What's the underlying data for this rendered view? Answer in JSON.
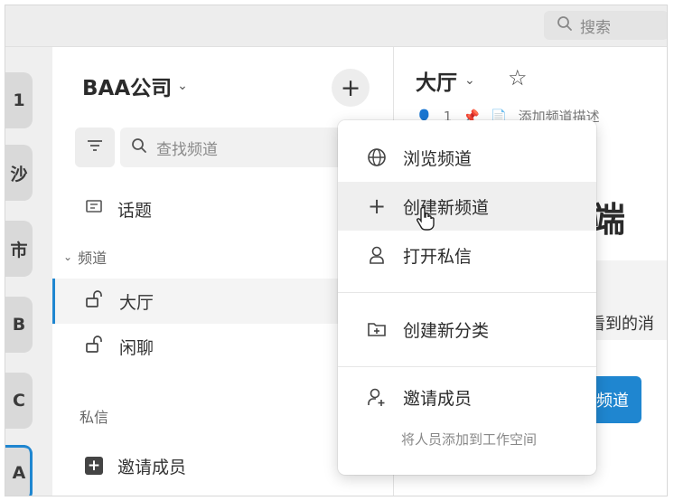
{
  "topbar": {
    "search_label": "搜索"
  },
  "workspaces": [
    {
      "label": "1"
    },
    {
      "label": "沙"
    },
    {
      "label": "市"
    },
    {
      "label": "B"
    },
    {
      "label": "C"
    },
    {
      "label": "A"
    }
  ],
  "sidebar": {
    "workspace_name": "BAA公司",
    "search_placeholder": "查找频道",
    "topics_label": "话题",
    "channels_section": "频道",
    "channels": [
      {
        "label": "大厅",
        "active": true
      },
      {
        "label": "闲聊",
        "active": false
      }
    ],
    "dm_section": "私信",
    "invite_label": "邀请成员"
  },
  "main": {
    "channel_title": "大厅",
    "member_count": "1",
    "add_description": "添加频道描述",
    "big_text": "端",
    "banner_text": "看到的消",
    "button_text": "频道"
  },
  "menu": {
    "items": [
      {
        "label": "浏览频道",
        "icon": "globe-icon"
      },
      {
        "label": "创建新频道",
        "icon": "plus-icon"
      },
      {
        "label": "打开私信",
        "icon": "person-icon"
      },
      {
        "label": "创建新分类",
        "icon": "folder-plus-icon"
      },
      {
        "label": "邀请成员",
        "icon": "person-plus-icon",
        "description": "将人员添加到工作空间"
      }
    ]
  },
  "colors": {
    "accent": "#1f86d0"
  }
}
